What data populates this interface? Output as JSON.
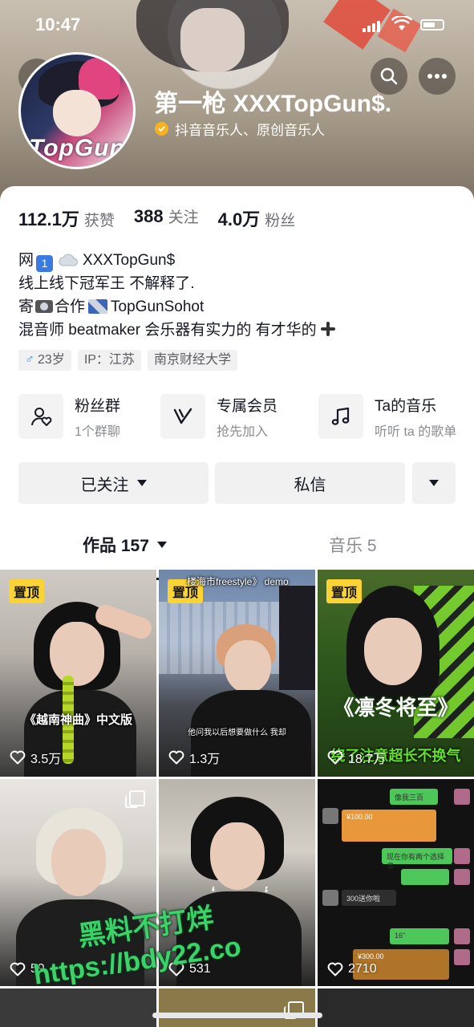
{
  "status_bar": {
    "time": "10:47"
  },
  "profile": {
    "nickname": "第一枪 XXXTopGun$.",
    "verification": "抖音音乐人、原创音乐人",
    "avatar_text": "TopGun"
  },
  "stats": [
    {
      "value": "112.1万",
      "label": "获赞"
    },
    {
      "value": "388",
      "label": "关注"
    },
    {
      "value": "4.0万",
      "label": "粉丝"
    }
  ],
  "bio": {
    "line1_prefix": "网",
    "line1_badge": "1",
    "line1_suffix": "XXXTopGun$",
    "line2": "线上线下冠军王 不解释了.",
    "line3_prefix": "寄",
    "line3_mid": "合作",
    "line3_suffix": "TopGunSohot",
    "line4": "混音师 beatmaker  会乐器有实力的 有才华的"
  },
  "tags": [
    {
      "icon": "♂",
      "text": "23岁"
    },
    {
      "text": "IP：江苏"
    },
    {
      "text": "南京财经大学"
    }
  ],
  "features": [
    {
      "title": "粉丝群",
      "subtitle": "1个群聊",
      "icon": "fan-group-icon"
    },
    {
      "title": "专属会员",
      "subtitle": "抢先加入",
      "icon": "vip-icon"
    },
    {
      "title": "Ta的音乐",
      "subtitle": "听听 ta 的歌单",
      "icon": "music-note-icon"
    }
  ],
  "actions": {
    "followed": "已关注",
    "message": "私信"
  },
  "tabs": [
    {
      "label": "作品 157",
      "active": true
    },
    {
      "label": "音乐 5",
      "active": false
    }
  ],
  "videos": [
    {
      "pinned": "置顶",
      "caption": "《越南神曲》中文版",
      "likes": "3.5万"
    },
    {
      "pinned": "置顶",
      "caption": "他问我以后想要做什么 我却",
      "top_caption": "楼海市freestyle》 demo",
      "likes": "1.3万"
    },
    {
      "pinned": "置顶",
      "caption": "《凛冬将至》",
      "sub_caption": "绕了注意超长不换气",
      "likes": "18.7万"
    },
    {
      "likes": "59"
    },
    {
      "likes": "531"
    },
    {
      "likes": "2710",
      "chat": [
        "像我三百",
        "¥100.00",
        "现在你有两个选择😎",
        "300送你啦",
        "16\"",
        "¥300.00"
      ]
    }
  ],
  "watermark": {
    "line1": "黑料不打烊",
    "line2": "https://bdy22.co"
  },
  "colors": {
    "pin_badge": "#fbd334",
    "verify_badge": "#f5b324",
    "male_icon": "#3c8ce7",
    "watermark": "#3bd26a"
  }
}
